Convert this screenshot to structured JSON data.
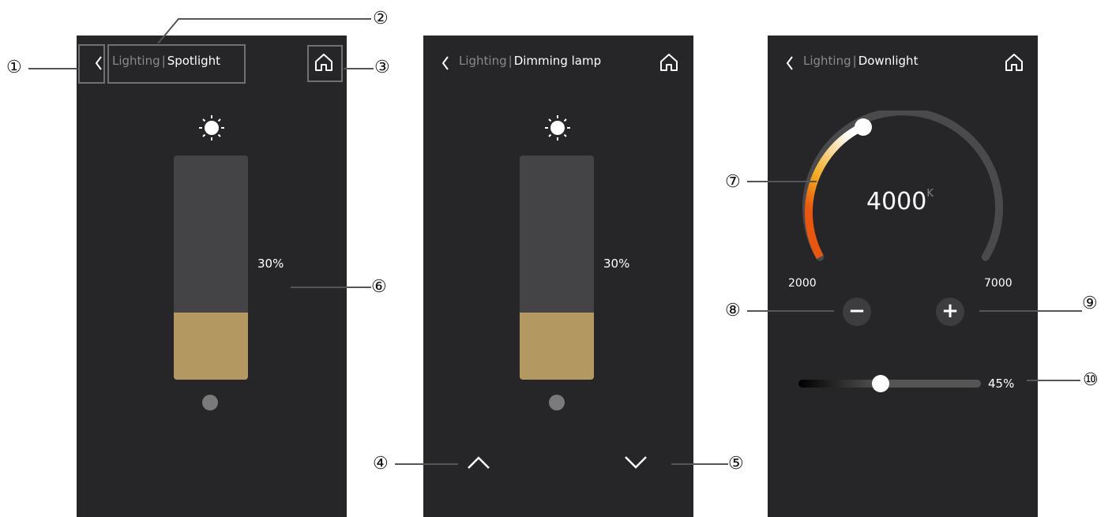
{
  "panels": [
    {
      "header": {
        "crumb": "Lighting",
        "sep": "|",
        "title": "Spotlight"
      },
      "level_text": "30%",
      "level": 0.3
    },
    {
      "header": {
        "crumb": "Lighting",
        "sep": "|",
        "title": "Dimming lamp"
      },
      "level_text": "30%",
      "level": 0.3
    },
    {
      "header": {
        "crumb": "Lighting",
        "sep": "|",
        "title": "Downlight"
      },
      "temp_value": "4000",
      "temp_unit": "K",
      "temp_min": "2000",
      "temp_max": "7000",
      "minus_label": "−",
      "plus_label": "+",
      "brightness_text": "45%",
      "brightness": 0.45,
      "temp_fraction": 0.4
    }
  ],
  "callouts": [
    "①",
    "②",
    "③",
    "④",
    "⑤",
    "⑥",
    "⑦",
    "⑧",
    "⑨",
    "⑩"
  ],
  "colors": {
    "panel_bg": "#262527",
    "fill": "#b39862",
    "track": "#444446"
  }
}
